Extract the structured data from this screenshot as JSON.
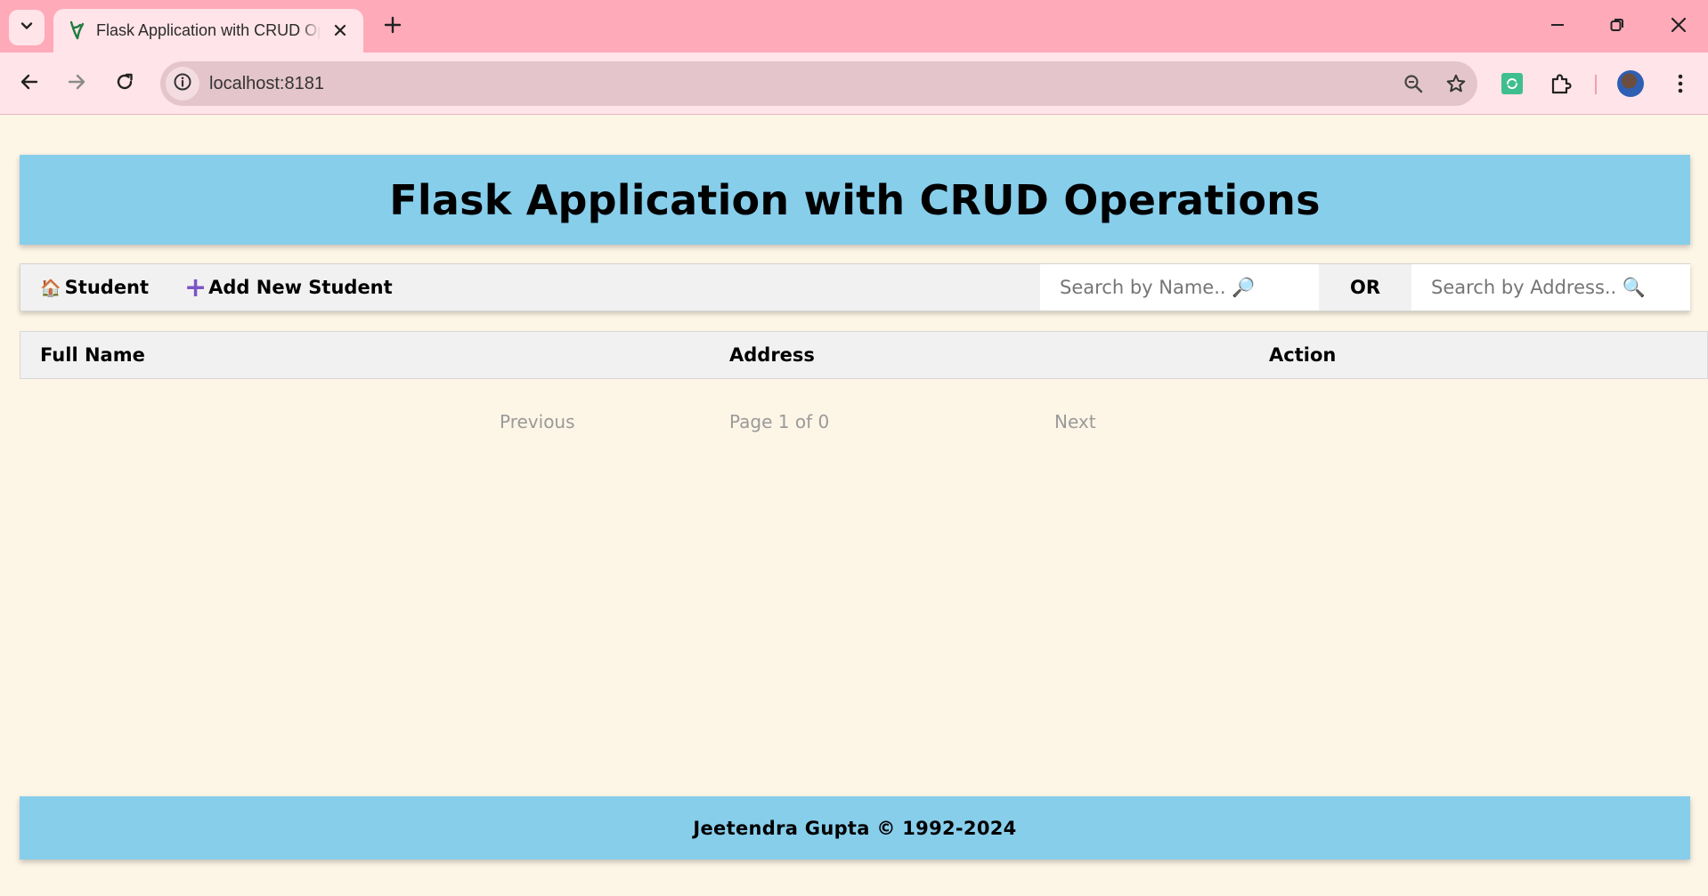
{
  "browser": {
    "tab_title": "Flask Application with CRUD Operations",
    "url": "localhost:8181"
  },
  "page": {
    "title": "Flask Application with CRUD Operations",
    "nav": {
      "home_icon": "🏠",
      "home_label": "Student",
      "add_icon": "+",
      "add_label": "Add New Student"
    },
    "search": {
      "name_placeholder": "Search by Name.. 🔎",
      "or_label": "OR",
      "address_placeholder": "Search by Address.. 🔍"
    },
    "table": {
      "columns": [
        "Full Name",
        "Address",
        "Action"
      ],
      "rows": []
    },
    "pagination": {
      "previous_label": "Previous",
      "page_info": "Page 1 of 0",
      "next_label": "Next"
    },
    "footer": "Jeetendra Gupta © 1992-2024"
  },
  "colors": {
    "header_bg": "#87ceeb",
    "page_bg": "#fdf5e6",
    "tabstrip_bg": "#ffaab9",
    "toolbar_bg": "#ffe4e9",
    "add_icon": "#7b55c7"
  }
}
